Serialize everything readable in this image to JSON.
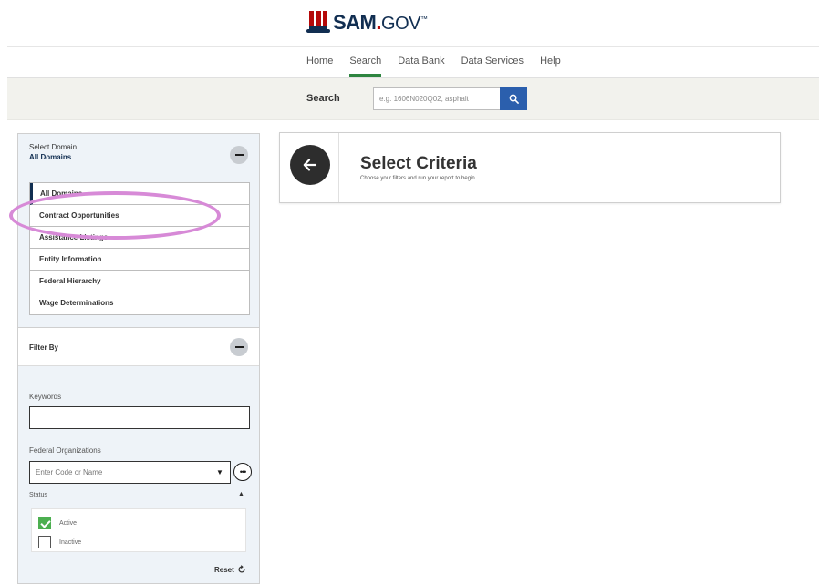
{
  "brand": {
    "name": "SAM",
    "dot": ".",
    "suffix": "GOV",
    "mark": "™",
    "colors": {
      "navy": "#112e51",
      "red": "#b50909"
    }
  },
  "nav": {
    "items": [
      {
        "label": "Home",
        "active": false
      },
      {
        "label": "Search",
        "active": true
      },
      {
        "label": "Data Bank",
        "active": false
      },
      {
        "label": "Data Services",
        "active": false
      },
      {
        "label": "Help",
        "active": false
      }
    ],
    "active_color": "#2e8540"
  },
  "search": {
    "label": "Search",
    "placeholder": "e.g. 1606N020Q02, asphalt",
    "button_icon": "search-icon",
    "button_color": "#2b5fad"
  },
  "sidebar": {
    "domain": {
      "title": "Select Domain",
      "value": "All Domains",
      "items": [
        {
          "label": "All Domains",
          "selected": true
        },
        {
          "label": "Contract Opportunities",
          "selected": false
        },
        {
          "label": "Assistance Listings",
          "selected": false
        },
        {
          "label": "Entity Information",
          "selected": false
        },
        {
          "label": "Federal Hierarchy",
          "selected": false
        },
        {
          "label": "Wage Determinations",
          "selected": false
        }
      ]
    },
    "filter": {
      "title": "Filter By",
      "keywords_label": "Keywords",
      "keywords_value": "",
      "orgs_label": "Federal Organizations",
      "orgs_placeholder": "Enter Code or Name",
      "status_label": "Status",
      "status_options": [
        {
          "label": "Active",
          "checked": true
        },
        {
          "label": "Inactive",
          "checked": false
        }
      ],
      "reset_label": "Reset"
    }
  },
  "main": {
    "title": "Select Criteria",
    "subtitle": "Choose your filters and run your report to begin."
  },
  "annotation": {
    "color": "#d78ad7",
    "target": "Contract Opportunities"
  }
}
